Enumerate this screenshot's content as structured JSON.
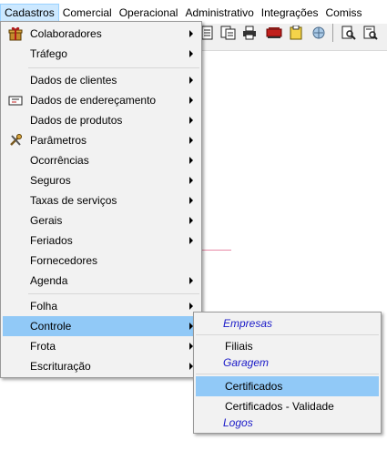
{
  "menubar": {
    "items": [
      {
        "label": "Cadastros",
        "active": true
      },
      {
        "label": "Comercial"
      },
      {
        "label": "Operacional"
      },
      {
        "label": "Administrativo"
      },
      {
        "label": "Integrações"
      },
      {
        "label": "Comiss"
      }
    ]
  },
  "toolbar": {
    "icons": [
      "document-icon",
      "copy-pages-icon",
      "printer-icon",
      "stamp-icon",
      "clipboard-icon",
      "network-icon",
      "find-document-icon",
      "report-search-icon"
    ]
  },
  "cadastros_menu": {
    "items": [
      {
        "label": "Colaboradores",
        "icon": "gift-box-icon",
        "submenu": true
      },
      {
        "label": "Tráfego",
        "submenu": true
      },
      {
        "label": "Dados de clientes",
        "submenu": true
      },
      {
        "label": "Dados de endereçamento",
        "icon": "address-card-icon",
        "submenu": true
      },
      {
        "label": "Dados de produtos",
        "submenu": true
      },
      {
        "label": "Parâmetros",
        "icon": "tools-icon",
        "submenu": true
      },
      {
        "label": "Ocorrências",
        "submenu": true
      },
      {
        "label": "Seguros",
        "submenu": true
      },
      {
        "label": "Taxas de serviços",
        "submenu": true
      },
      {
        "label": "Gerais",
        "submenu": true
      },
      {
        "label": "Feriados",
        "submenu": true
      },
      {
        "label": "Fornecedores",
        "submenu": false
      },
      {
        "label": "Agenda",
        "submenu": true
      },
      {
        "label": "Folha",
        "submenu": true
      },
      {
        "label": "Controle",
        "submenu": true,
        "highlighted": true
      },
      {
        "label": "Frota",
        "submenu": true
      },
      {
        "label": "Escrituração",
        "submenu": true
      }
    ]
  },
  "controle_submenu": {
    "items": [
      {
        "label": "Empresas",
        "kind": "header"
      },
      {
        "label": "Filiais",
        "kind": "item"
      },
      {
        "label": "Garagem",
        "kind": "header"
      },
      {
        "label": "Certificados",
        "kind": "item",
        "highlighted": true
      },
      {
        "label": "Certificados - Validade",
        "kind": "item"
      },
      {
        "label": "Logos",
        "kind": "header"
      }
    ]
  },
  "colors": {
    "highlight": "#91c9f7",
    "menubar_active": "#cce8ff",
    "header_text": "#1a1ac8",
    "menu_bg": "#f2f2f2"
  }
}
